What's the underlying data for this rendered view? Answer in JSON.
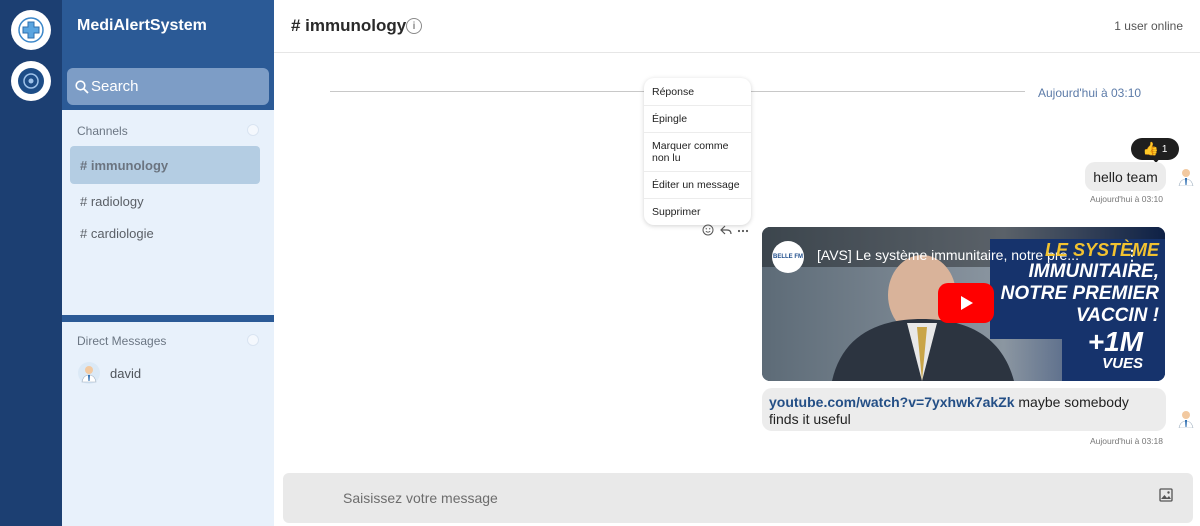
{
  "app": {
    "title": "MediAlertSystem"
  },
  "search": {
    "placeholder": "Search"
  },
  "sidebar": {
    "channels_label": "Channels",
    "channels": [
      {
        "label": "# immunology",
        "active": true
      },
      {
        "label": "# radiology",
        "active": false
      },
      {
        "label": "# cardiologie",
        "active": false
      }
    ],
    "dm_label": "Direct Messages",
    "dms": [
      {
        "name": "david"
      }
    ]
  },
  "header": {
    "channel": "# immunology",
    "online": "1 user online"
  },
  "chat": {
    "date_separator": "Aujourd'hui à 03:10",
    "context_menu": [
      "Réponse",
      "Épingle",
      "Marquer comme non lu",
      "Éditer un message",
      "Supprimer"
    ],
    "messages": [
      {
        "text": "hello team",
        "time": "Aujourd'hui à 03:10",
        "reaction": {
          "emoji": "👍",
          "count": "1"
        }
      },
      {
        "link": "youtube.com/watch?v=7yxhwk7akZk",
        "text": " maybe somebody finds it useful",
        "time": "Aujourd'hui à 03:18",
        "video": {
          "title": "[AVS] Le système immunitaire, notre pre...",
          "overlay_line1": "LE SYSTÈME",
          "overlay_line2": "IMMUNITAIRE,",
          "overlay_line3": "NOTRE PREMIER",
          "overlay_line4": "VACCIN !",
          "overlay_line5": "+1M",
          "overlay_line6": "VUES",
          "channel_logo": "BELLE FM"
        }
      }
    ]
  },
  "composer": {
    "placeholder": "Saisissez votre message"
  },
  "colors": {
    "rail": "#1c3f72",
    "sidebar_header": "#2b5a96",
    "sidebar_bg": "#e8f1fb",
    "active_channel": "#b4cde3",
    "link": "#244f86"
  }
}
